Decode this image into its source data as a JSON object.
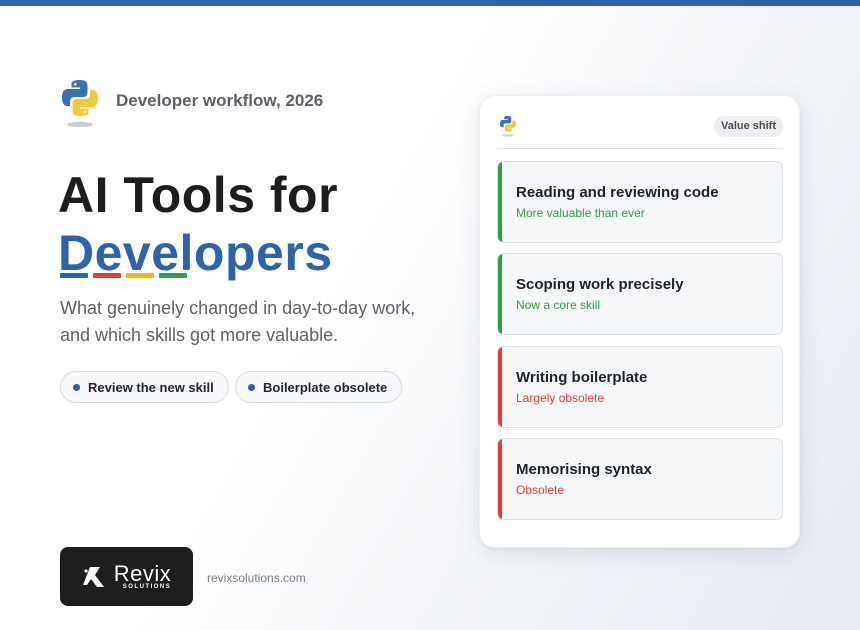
{
  "colors": {
    "accent": "#2e63a6",
    "green": "#2e9e4a",
    "red": "#e0403a",
    "yellow": "#f2b41c"
  },
  "header": {
    "logo_icon": "python-logo-icon",
    "eyebrow": "Developer workflow, 2026"
  },
  "hero": {
    "title_line1": "AI Tools for",
    "title_line2": "Developers",
    "subtitle_line1": "What genuinely changed in day-to-day work,",
    "subtitle_line2": "and which skills got more valuable."
  },
  "chips": [
    {
      "label": "Review the new skill"
    },
    {
      "label": "Boilerplate obsolete"
    }
  ],
  "card": {
    "badge": "Value shift",
    "items": [
      {
        "title": "Reading and reviewing code",
        "note": "More valuable than ever",
        "status": "up"
      },
      {
        "title": "Scoping work precisely",
        "note": "Now a core skill",
        "status": "up"
      },
      {
        "title": "Writing boilerplate",
        "note": "Largely obsolete",
        "status": "down"
      },
      {
        "title": "Memorising syntax",
        "note": "Obsolete",
        "status": "down"
      }
    ]
  },
  "footer": {
    "brand_name": "Revix",
    "brand_sub": "SOLUTIONS",
    "site": "revixsolutions.com"
  }
}
